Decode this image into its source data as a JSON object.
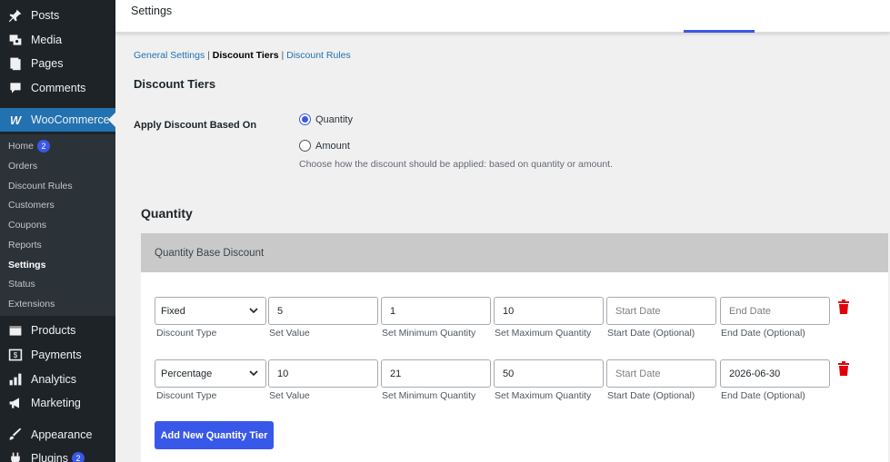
{
  "sidebar": {
    "items": [
      {
        "label": "Posts",
        "icon": "pin-icon"
      },
      {
        "label": "Media",
        "icon": "media-icon"
      },
      {
        "label": "Pages",
        "icon": "pages-icon"
      },
      {
        "label": "Comments",
        "icon": "comments-icon"
      },
      {
        "label": "WooCommerce",
        "icon": "woocommerce-icon"
      },
      {
        "label": "Products",
        "icon": "products-icon"
      },
      {
        "label": "Payments",
        "icon": "payments-icon"
      },
      {
        "label": "Analytics",
        "icon": "analytics-icon"
      },
      {
        "label": "Marketing",
        "icon": "marketing-icon"
      },
      {
        "label": "Appearance",
        "icon": "appearance-icon"
      },
      {
        "label": "Plugins",
        "icon": "plugins-icon",
        "badge": "2"
      }
    ],
    "submenu": [
      {
        "label": "Home",
        "badge": "2"
      },
      {
        "label": "Orders"
      },
      {
        "label": "Discount Rules"
      },
      {
        "label": "Customers"
      },
      {
        "label": "Coupons"
      },
      {
        "label": "Reports"
      },
      {
        "label": "Settings"
      },
      {
        "label": "Status"
      },
      {
        "label": "Extensions"
      }
    ]
  },
  "topbar": {
    "title": "Settings"
  },
  "tabs": {
    "general": "General Settings",
    "sep1": "|",
    "tiers": "Discount Tiers",
    "sep2": "|",
    "rules": "Discount Rules"
  },
  "section": {
    "heading": "Discount Tiers",
    "apply_label": "Apply Discount Based On",
    "options": [
      "Quantity",
      "Amount"
    ],
    "selected": "Quantity",
    "description": "Choose how the discount should be applied: based on quantity or amount."
  },
  "quantity": {
    "title": "Quantity",
    "panel_header": "Quantity Base Discount",
    "labels": {
      "discount_type": "Discount Type",
      "set_value": "Set Value",
      "min_qty": "Set Minimum Quantity",
      "max_qty": "Set Maximum Quantity",
      "start_date": "Start Date (Optional)",
      "end_date": "End Date (Optional)"
    },
    "rows": [
      {
        "type": "Fixed",
        "value": "5",
        "min": "1",
        "max": "10",
        "start": "Start Date",
        "end": "End Date"
      },
      {
        "type": "Percentage",
        "value": "10",
        "min": "21",
        "max": "50",
        "start": "Start Date",
        "end": "2026-06-30"
      }
    ],
    "add_button": "Add New Quantity Tier"
  },
  "colors": {
    "accent": "#3858e9",
    "sidebar": "#1d2327",
    "active": "#2271b1",
    "danger": "#e0000b"
  }
}
